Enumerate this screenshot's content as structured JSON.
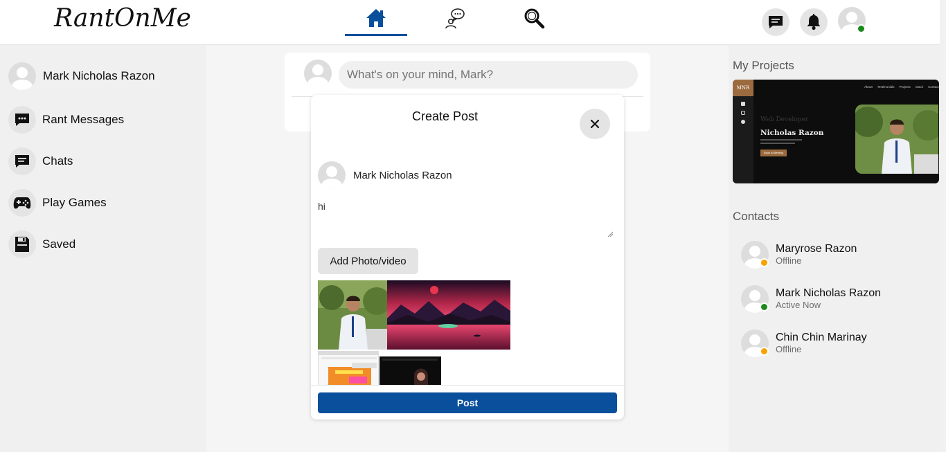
{
  "app": {
    "logo": "RantOnMe"
  },
  "header": {
    "nav": [
      {
        "name": "home",
        "active": true
      },
      {
        "name": "rants",
        "active": false
      },
      {
        "name": "search",
        "active": false
      }
    ],
    "right_icons": [
      "messages-icon",
      "notifications-icon",
      "profile-avatar"
    ],
    "profile_status": "online"
  },
  "sidebar": {
    "user_name": "Mark Nicholas Razon",
    "items": [
      {
        "label": "Rant Messages",
        "icon": "rant-messages-icon"
      },
      {
        "label": "Chats",
        "icon": "chats-icon"
      },
      {
        "label": "Play Games",
        "icon": "gamepad-icon"
      },
      {
        "label": "Saved",
        "icon": "saved-icon"
      }
    ]
  },
  "composer": {
    "placeholder": "What's on your mind, Mark?"
  },
  "modal": {
    "title": "Create Post",
    "user_name": "Mark Nicholas Razon",
    "post_text": "hi",
    "add_media_label": "Add Photo/video",
    "post_label": "Post",
    "attachments": [
      "portrait-photo",
      "landscape-sunset-image",
      "screenshot-video-editing",
      "screenshot-dark-video"
    ]
  },
  "right": {
    "projects_title": "My Projects",
    "project": {
      "logo": "MNR",
      "nav": [
        "About",
        "Testimonials",
        "Projects",
        "Stack",
        "Contact"
      ],
      "tagline": "Web Developer",
      "name": "Nicholas Razon",
      "button": "Book a Meeting"
    },
    "contacts_title": "Contacts",
    "contacts": [
      {
        "name": "Maryrose Razon",
        "status": "Offline",
        "status_color": "#f4a300"
      },
      {
        "name": "Mark Nicholas Razon",
        "status": "Active Now",
        "status_color": "#1b8a1b"
      },
      {
        "name": "Chin Chin Marinay",
        "status": "Offline",
        "status_color": "#f4a300"
      }
    ]
  },
  "colors": {
    "accent": "#0a4f9b",
    "online": "#1b8a1b",
    "away": "#f4a300"
  }
}
